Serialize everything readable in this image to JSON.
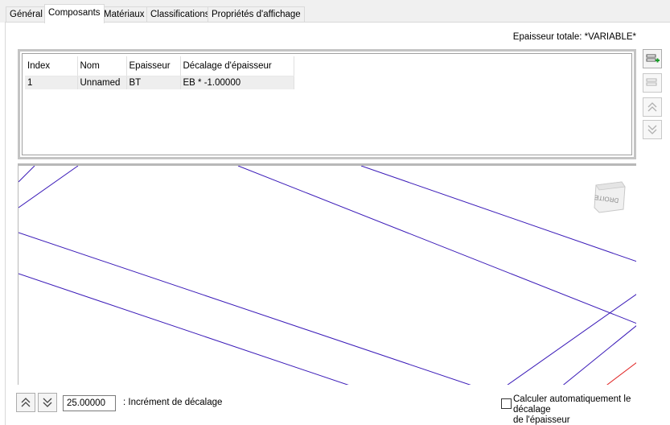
{
  "tabs": [
    {
      "label": "Général"
    },
    {
      "label": "Composants"
    },
    {
      "label": "Matériaux"
    },
    {
      "label": "Classifications"
    },
    {
      "label": "Propriétés d'affichage"
    }
  ],
  "header": {
    "total_thickness": "Epaisseur totale: *VARIABLE*"
  },
  "grid": {
    "columns": [
      "Index",
      "Nom",
      "Epaisseur",
      "Décalage d'épaisseur"
    ],
    "rows": [
      [
        "1",
        "Unnamed",
        "BT",
        "EB * -1.00000"
      ]
    ]
  },
  "side_buttons": {
    "add": "add-component-icon",
    "remove": "remove-component-icon",
    "up": "move-up-icon",
    "down": "move-down-icon"
  },
  "viewcube": {
    "face_label": "DROITE"
  },
  "footer": {
    "increment_value": "25.00000",
    "increment_label": ": Incrément de décalage",
    "auto_calc_line1": "Calculer automatiquement le décalage",
    "auto_calc_line2": "de l'épaisseur"
  },
  "colors": {
    "line": "#3a1ab8",
    "accent_line": "#e02020",
    "add_green": "#1a9c2a"
  }
}
